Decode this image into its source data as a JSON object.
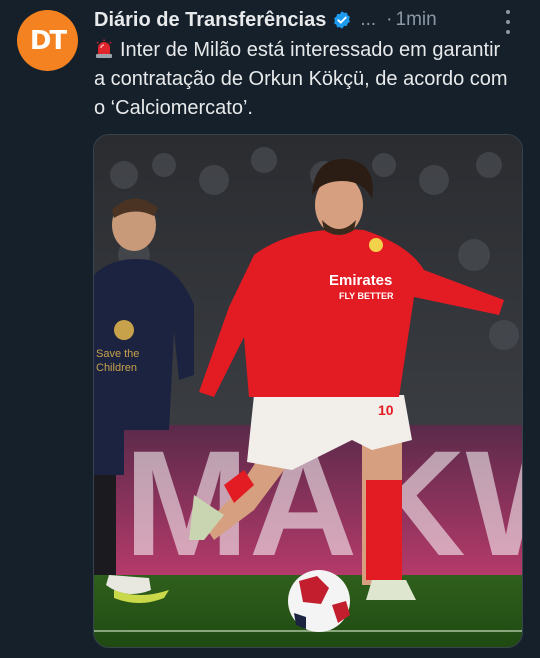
{
  "tweet": {
    "author_name": "Diário de Transferências",
    "handle": "...",
    "separator": "·",
    "time": "1min",
    "avatar_text": "DT",
    "text": "Inter de Milão  está interessado em garantir a contratação de Orkun Kökçü, de acordo com o ‘Calciomercato’."
  },
  "media": {
    "sponsor_text_1": "Emirates",
    "sponsor_text_2": "FLY BETTER",
    "shirt_number": "10",
    "opponent_shirt_text_1": "Save the",
    "opponent_shirt_text_2": "Children",
    "ad_board_text": "MAKW"
  },
  "colors": {
    "background": "#15202b",
    "avatar": "#f58220",
    "verified": "#1d9bf0",
    "benfica_red": "#e31b23"
  },
  "icons": [
    "verified-badge-icon",
    "more-options-icon",
    "siren-emoji-icon"
  ]
}
